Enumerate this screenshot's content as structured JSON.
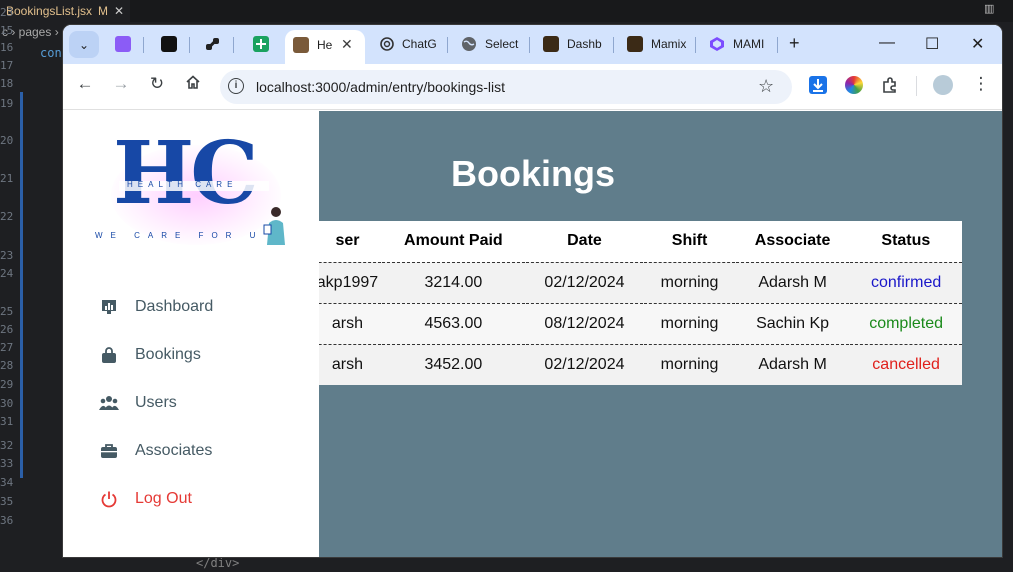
{
  "editor": {
    "tab_name": "BookingsList.jsx",
    "tab_modified": "M",
    "tab_close": "✕",
    "breadcrumb": "c › pages ›",
    "top_code": "con",
    "bottom_code": "</div>",
    "line_numbers": [
      "23",
      "15",
      "16",
      "17",
      "18",
      "19",
      "20",
      "21",
      "22",
      "23",
      "24",
      "25",
      "26",
      "27",
      "28",
      "29",
      "30",
      "31",
      "32",
      "33",
      "34",
      "35",
      "36"
    ]
  },
  "browser": {
    "tabs": [
      {
        "title": "He",
        "active": true
      },
      {
        "title": "ChatG",
        "active": false
      },
      {
        "title": "Select",
        "active": false
      },
      {
        "title": "Dashb",
        "active": false
      },
      {
        "title": "Mamix",
        "active": false
      },
      {
        "title": "MAMI",
        "active": false
      }
    ],
    "new_tab": "+",
    "url": "localhost:3000/admin/entry/bookings-list",
    "controls": {
      "minimize": "—",
      "maximize": "☐",
      "close": "✕"
    }
  },
  "sidebar": {
    "logo": {
      "big": "HC",
      "sub": "HEALTH   CARE",
      "tagline": "WE CARE FOR U"
    },
    "items": [
      {
        "label": "Dashboard",
        "icon": "chart-icon"
      },
      {
        "label": "Bookings",
        "icon": "bag-icon"
      },
      {
        "label": "Users",
        "icon": "users-icon"
      },
      {
        "label": "Associates",
        "icon": "briefcase-icon"
      },
      {
        "label": "Log Out",
        "icon": "power-icon"
      }
    ]
  },
  "main": {
    "title": "Bookings",
    "columns": [
      "ser",
      "Amount Paid",
      "Date",
      "Shift",
      "Associate",
      "Status"
    ],
    "rows": [
      {
        "user": "akp1997",
        "amount": "3214.00",
        "date": "02/12/2024",
        "shift": "morning",
        "associate": "Adarsh M",
        "status": "confirmed"
      },
      {
        "user": "arsh",
        "amount": "4563.00",
        "date": "08/12/2024",
        "shift": "morning",
        "associate": "Sachin Kp",
        "status": "completed"
      },
      {
        "user": "arsh",
        "amount": "3452.00",
        "date": "02/12/2024",
        "shift": "morning",
        "associate": "Adarsh M",
        "status": "cancelled"
      }
    ]
  },
  "colors": {
    "page_bg": "#607d8b",
    "confirmed": "#1a17c9",
    "completed": "#1b8a1b",
    "cancelled": "#e0201b",
    "logout": "#e53935"
  }
}
